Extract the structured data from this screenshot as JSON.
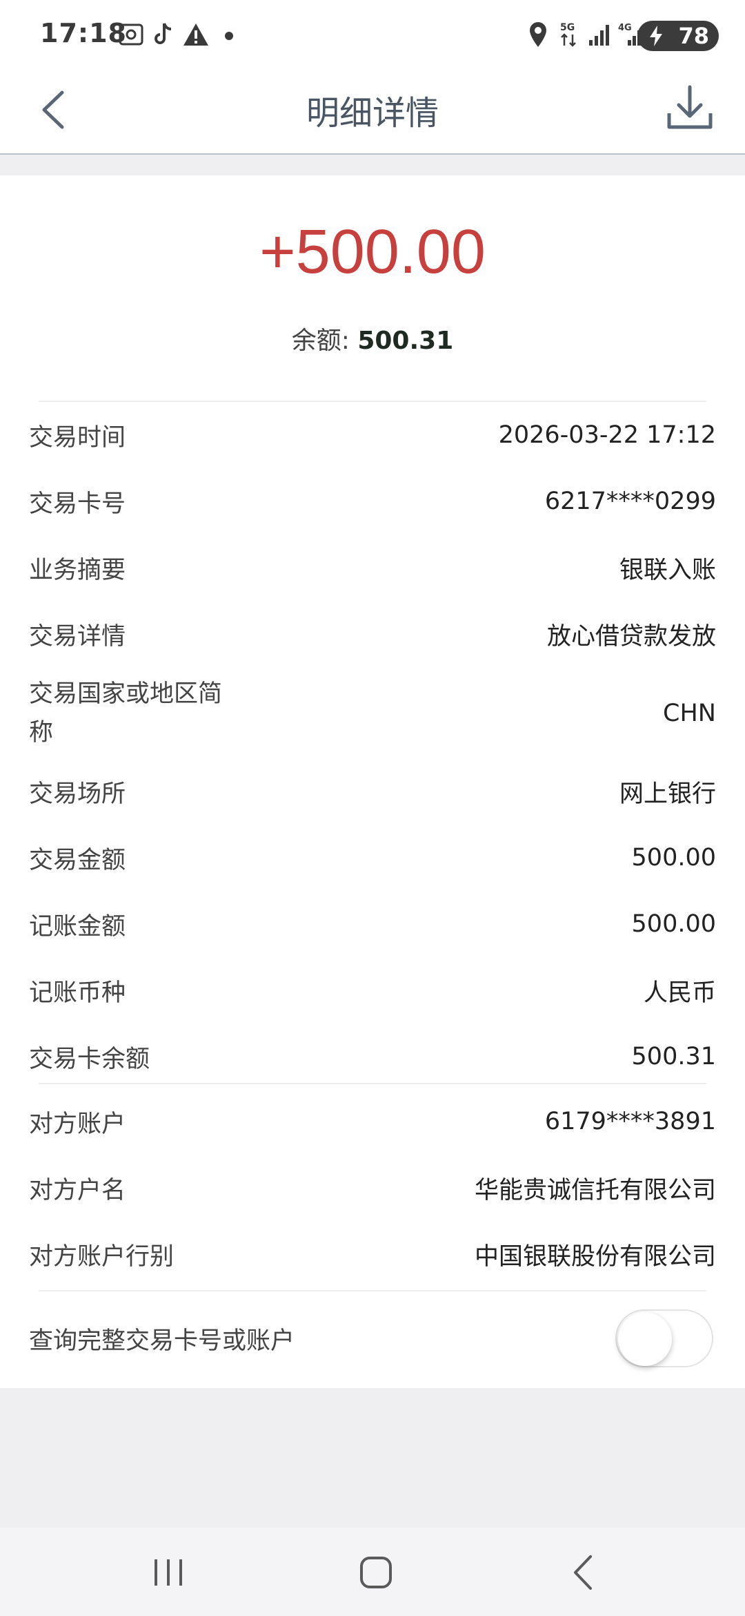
{
  "status_bar": {
    "time": "17:18",
    "battery": "78",
    "icons": [
      "screenshot-icon",
      "tiktok-icon",
      "warning-icon",
      "dot-icon",
      "location-icon",
      "5g-icon",
      "signal-icon",
      "4g-signal-icon"
    ]
  },
  "header": {
    "title": "明细详情",
    "back_icon": "chevron-left-icon",
    "download_icon": "download-icon"
  },
  "summary": {
    "amount": "+500.00",
    "balance_label": "余额:",
    "balance_value": "500.31",
    "amount_color": "#c8403d"
  },
  "details": [
    {
      "label": "交易时间",
      "value": "2026-03-22 17:12"
    },
    {
      "label": "交易卡号",
      "value": "6217****0299"
    },
    {
      "label": "业务摘要",
      "value": "银联入账"
    },
    {
      "label": "交易详情",
      "value": "放心借贷款发放"
    },
    {
      "label": "交易国家或地区简称",
      "value": "CHN"
    },
    {
      "label": "交易场所",
      "value": "网上银行"
    },
    {
      "label": "交易金额",
      "value": "500.00"
    },
    {
      "label": "记账金额",
      "value": "500.00"
    },
    {
      "label": "记账币种",
      "value": "人民币"
    },
    {
      "label": "交易卡余额",
      "value": "500.31"
    }
  ],
  "counterparty": [
    {
      "label": "对方账户",
      "value": "6179****3891"
    },
    {
      "label": "对方户名",
      "value": "华能贵诚信托有限公司"
    },
    {
      "label": "对方账户行别",
      "value": "中国银联股份有限公司"
    }
  ],
  "toggle_row": {
    "label": "查询完整交易卡号或账户",
    "on": false
  },
  "nav": {
    "icons": [
      "recent-apps-icon",
      "home-icon",
      "back-icon"
    ]
  }
}
